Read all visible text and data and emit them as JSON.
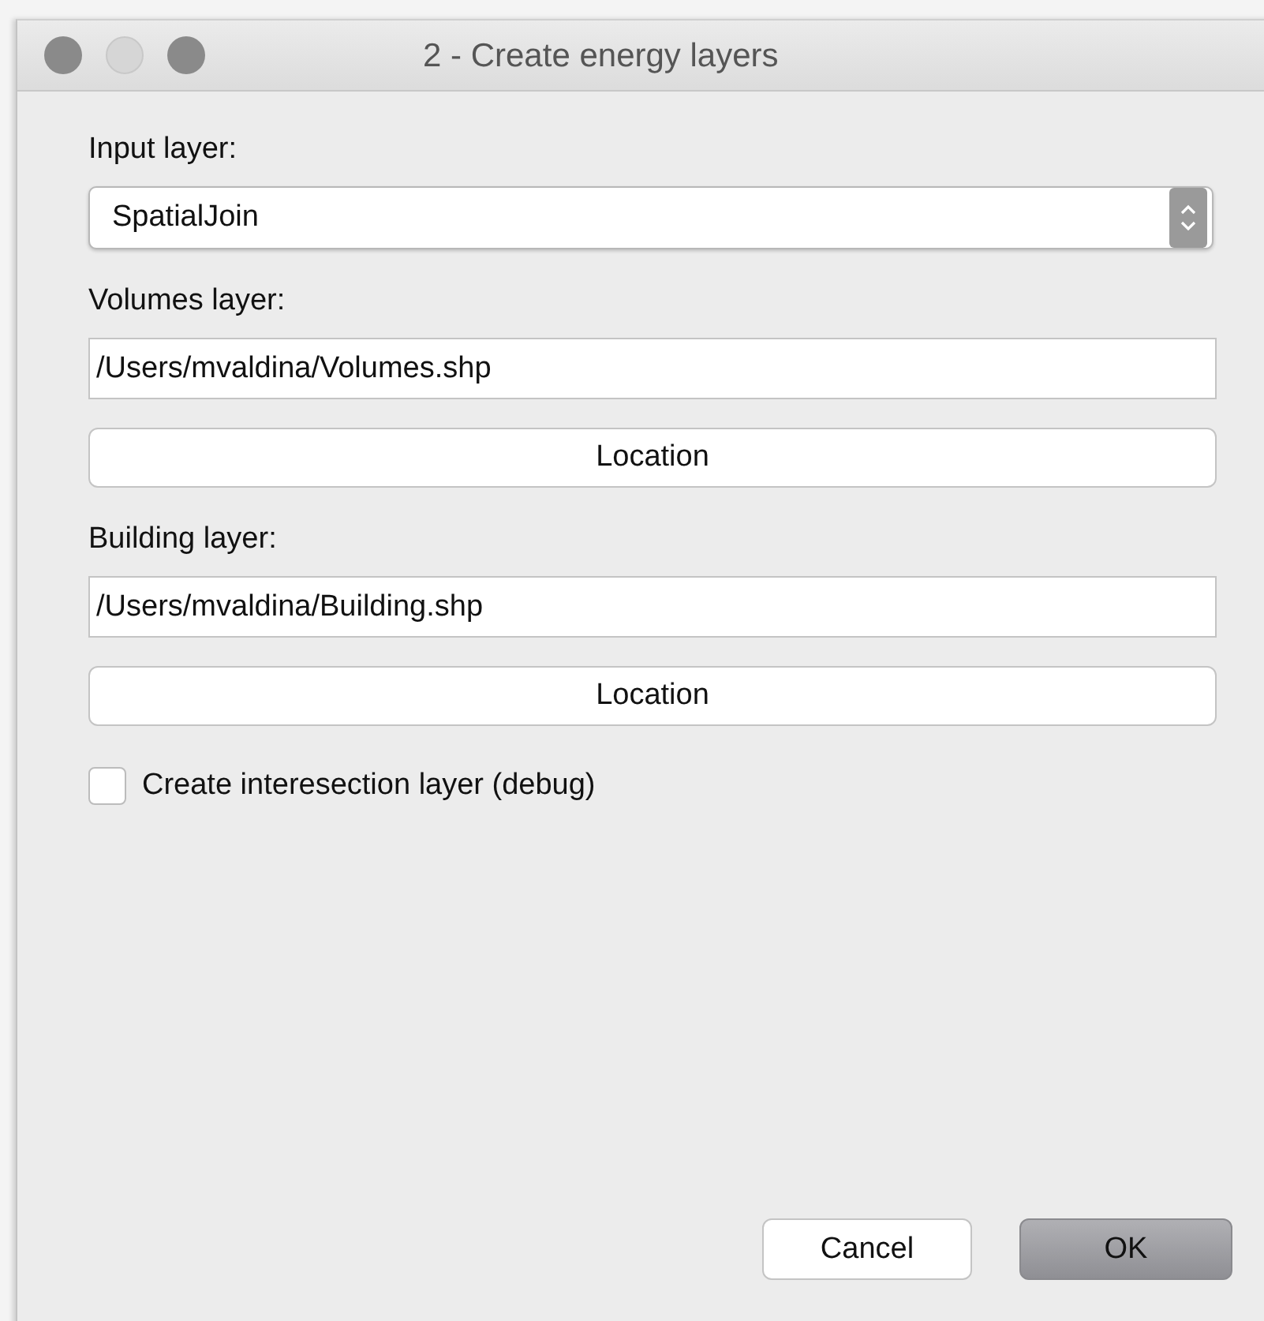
{
  "window": {
    "title": "2 - Create energy layers"
  },
  "input_layer": {
    "label": "Input layer:",
    "value": "SpatialJoin"
  },
  "sections": [
    {
      "label": "Volumes layer:",
      "value": "/Users/mvaldina/Volumes.shp",
      "button": "Location"
    },
    {
      "label": "Building layer:",
      "value": "/Users/mvaldina/Building.shp",
      "button": "Location"
    }
  ],
  "debug_option": {
    "label": "Create interesection layer (debug)",
    "checked": false
  },
  "buttons": [
    {
      "label": "Cancel",
      "kind": "secondary"
    },
    {
      "label": "OK",
      "kind": "default"
    }
  ]
}
